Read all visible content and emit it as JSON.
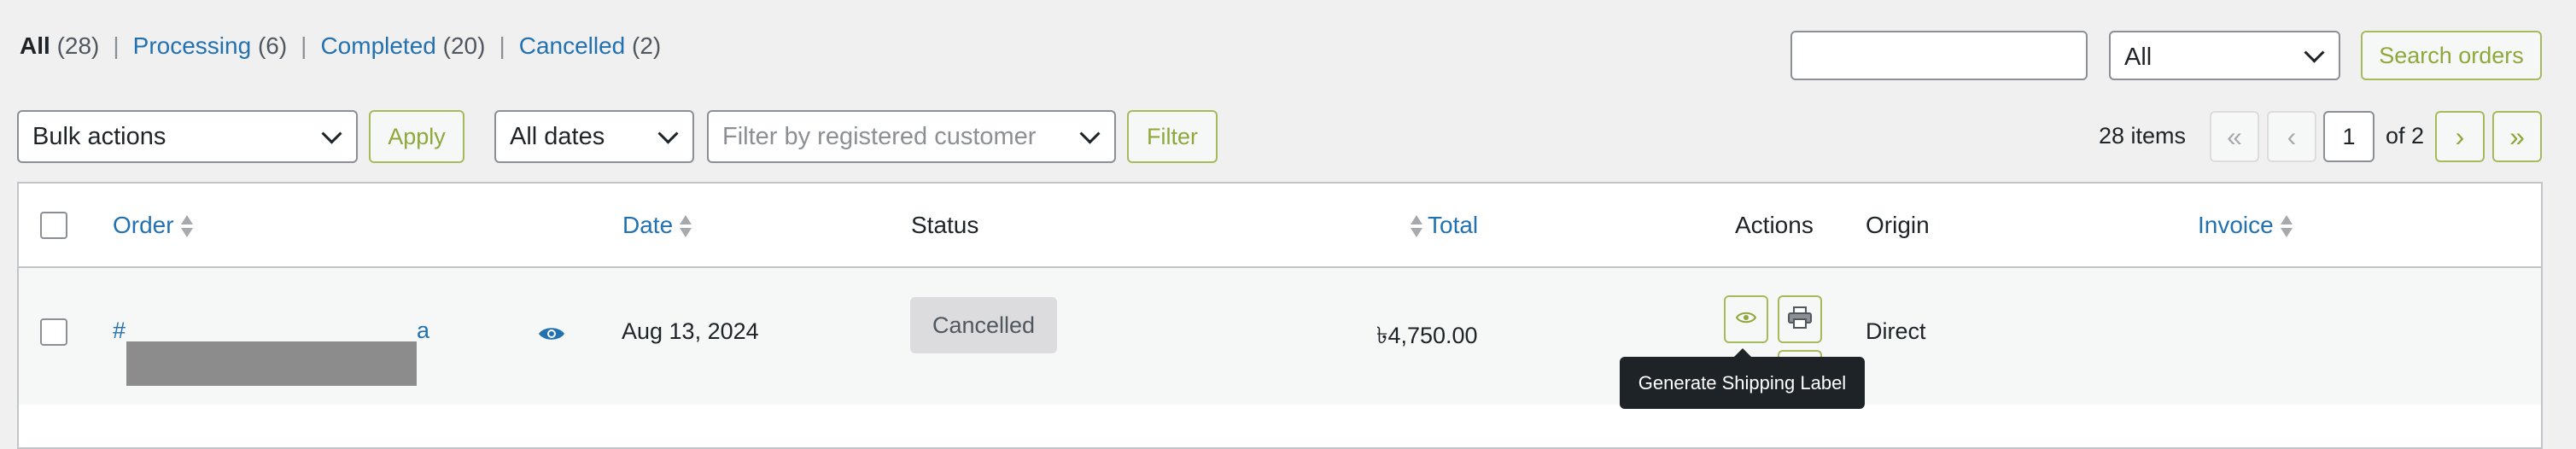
{
  "filters": {
    "all_label": "All",
    "all_count": "(28)",
    "processing_label": "Processing",
    "processing_count": "(6)",
    "completed_label": "Completed",
    "completed_count": "(20)",
    "cancelled_label": "Cancelled",
    "cancelled_count": "(2)",
    "separator": "|"
  },
  "search": {
    "input_value": "",
    "type_select": "All",
    "button_label": "Search orders"
  },
  "toolbar": {
    "bulk_actions": "Bulk actions",
    "apply_label": "Apply",
    "dates_select": "All dates",
    "customer_placeholder": "Filter by registered customer",
    "filter_label": "Filter"
  },
  "pagination": {
    "items_count": "28 items",
    "first": "«",
    "prev": "‹",
    "current_page": "1",
    "of_total": "of 2",
    "next": "›",
    "last": "»"
  },
  "table": {
    "columns": {
      "order": "Order",
      "date": "Date",
      "status": "Status",
      "total": "Total",
      "actions": "Actions",
      "origin": "Origin",
      "invoice": "Invoice"
    },
    "rows": [
      {
        "order_prefix": "#",
        "order_suffix": "a",
        "date": "Aug 13, 2024",
        "status": "Cancelled",
        "total": "৳4,750.00",
        "origin": "Direct"
      }
    ]
  },
  "tooltip": "Generate Shipping Label",
  "colors": {
    "link": "#2271b1",
    "accent": "#8fa83a",
    "status_cancelled_bg": "#dcdcde"
  },
  "icons": [
    "sort-icon",
    "eye-icon",
    "printer-icon",
    "chevron-down-icon"
  ]
}
